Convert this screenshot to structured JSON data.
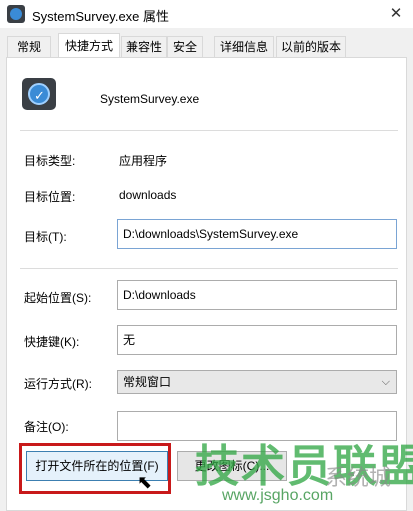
{
  "window": {
    "title": "SystemSurvey.exe 属性",
    "close": "✕"
  },
  "tabs": [
    {
      "label": "常规"
    },
    {
      "label": "快捷方式"
    },
    {
      "label": "兼容性"
    },
    {
      "label": "安全"
    },
    {
      "label": "详细信息"
    },
    {
      "label": "以前的版本"
    }
  ],
  "app": {
    "name": "SystemSurvey.exe",
    "icon": "app-icon"
  },
  "fields": {
    "target_type": {
      "label": "目标类型:",
      "value": "应用程序"
    },
    "target_location": {
      "label": "目标位置:",
      "value": "downloads"
    },
    "target": {
      "label": "目标(T):",
      "value": "D:\\downloads\\SystemSurvey.exe"
    },
    "start_in": {
      "label": "起始位置(S):",
      "value": "D:\\downloads"
    },
    "shortcut_key": {
      "label": "快捷键(K):",
      "value": "无"
    },
    "run": {
      "label": "运行方式(R):",
      "value": "常规窗口"
    },
    "comment": {
      "label": "备注(O):",
      "value": ""
    }
  },
  "buttons": {
    "open_location": "打开文件所在的位置(F)",
    "change_icon": "更改图标(C)..."
  },
  "watermark": {
    "main": "技术员联盟",
    "url": "www.jsgho.com",
    "extra": "系统城"
  },
  "colors": {
    "highlight": "#c8191a",
    "watermark": "#35a848",
    "accent": "#3a8bd6"
  }
}
